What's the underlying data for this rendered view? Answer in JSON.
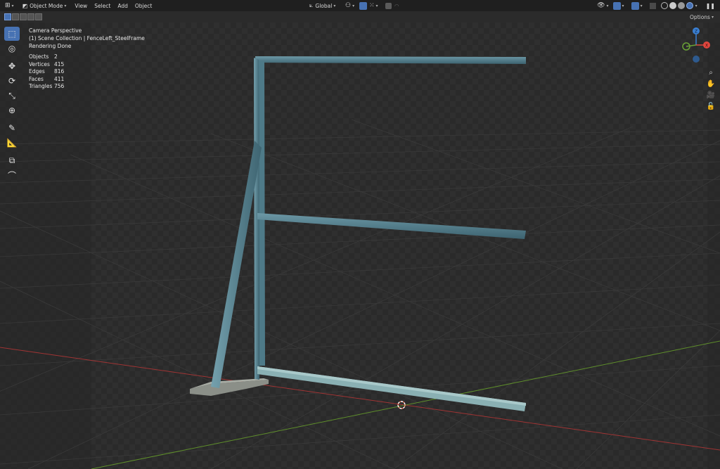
{
  "header": {
    "mode_label": "Object Mode",
    "menus": [
      "View",
      "Select",
      "Add",
      "Object"
    ],
    "transform_orientation": "Global"
  },
  "subbar": {
    "options_label": "Options"
  },
  "overlay": {
    "view_name": "Camera Perspective",
    "collection_line": "(1) Scene Collection | FenceLeft_SteelFrame",
    "render_status": "Rendering Done",
    "stats": [
      {
        "label": "Objects",
        "value": "2"
      },
      {
        "label": "Vertices",
        "value": "415"
      },
      {
        "label": "Edges",
        "value": "816"
      },
      {
        "label": "Faces",
        "value": "411"
      },
      {
        "label": "Triangles",
        "value": "756"
      }
    ]
  },
  "gizmo": {
    "x_label": "X",
    "y_label": "Y",
    "z_label": "Z"
  },
  "colors": {
    "accent": "#4772b3",
    "x_axis": "#e0463e",
    "y_axis": "#6aa236",
    "z_axis": "#3a7fd2",
    "steel": "#5d8a99"
  },
  "icons": {
    "tools": [
      "select-box-icon",
      "cursor-icon",
      "move-icon",
      "rotate-icon",
      "scale-icon",
      "transform-icon",
      "annotate-icon",
      "measure-icon",
      "add-cube-icon",
      "curve-icon"
    ],
    "nav": [
      "zoom-icon",
      "hand-icon",
      "camera-icon",
      "lock-icon"
    ]
  }
}
